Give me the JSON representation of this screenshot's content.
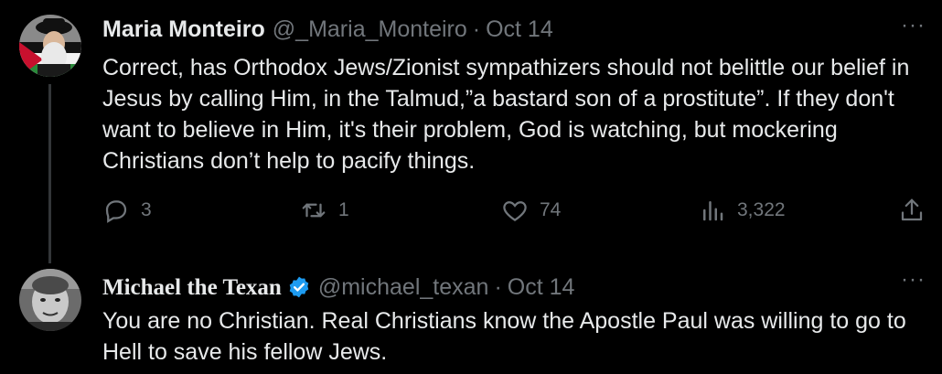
{
  "tweets": [
    {
      "author_name": "Maria Monteiro",
      "handle": "@_Maria_Monteiro",
      "separator": "·",
      "date": "Oct 14",
      "more_label": "···",
      "text": "Correct, has Orthodox Jews/Zionist sympathizers should not belittle our belief in Jesus by calling Him, in the Talmud,”a bastard son of a prostitute”. If they don't want to believe in Him, it's their problem, God is watching, but mockering Christians don’t help to pacify things.",
      "actions": {
        "replies": "3",
        "retweets": "1",
        "likes": "74",
        "views": "3,322"
      }
    },
    {
      "author_name": "Michael the Texan",
      "handle": "@michael_texan",
      "separator": "·",
      "date": "Oct 14",
      "more_label": "···",
      "verified": true,
      "text": "You are no Christian. Real Christians know the Apostle Paul was willing to go to Hell to save his fellow Jews."
    }
  ],
  "colors": {
    "background": "#000000",
    "text": "#e7e9ea",
    "secondary": "#71767b",
    "verified": "#1d9bf0",
    "thread_line": "#333639"
  },
  "icons": [
    "reply-icon",
    "retweet-icon",
    "like-icon",
    "views-icon",
    "share-icon",
    "verified-badge-icon",
    "more-icon"
  ]
}
